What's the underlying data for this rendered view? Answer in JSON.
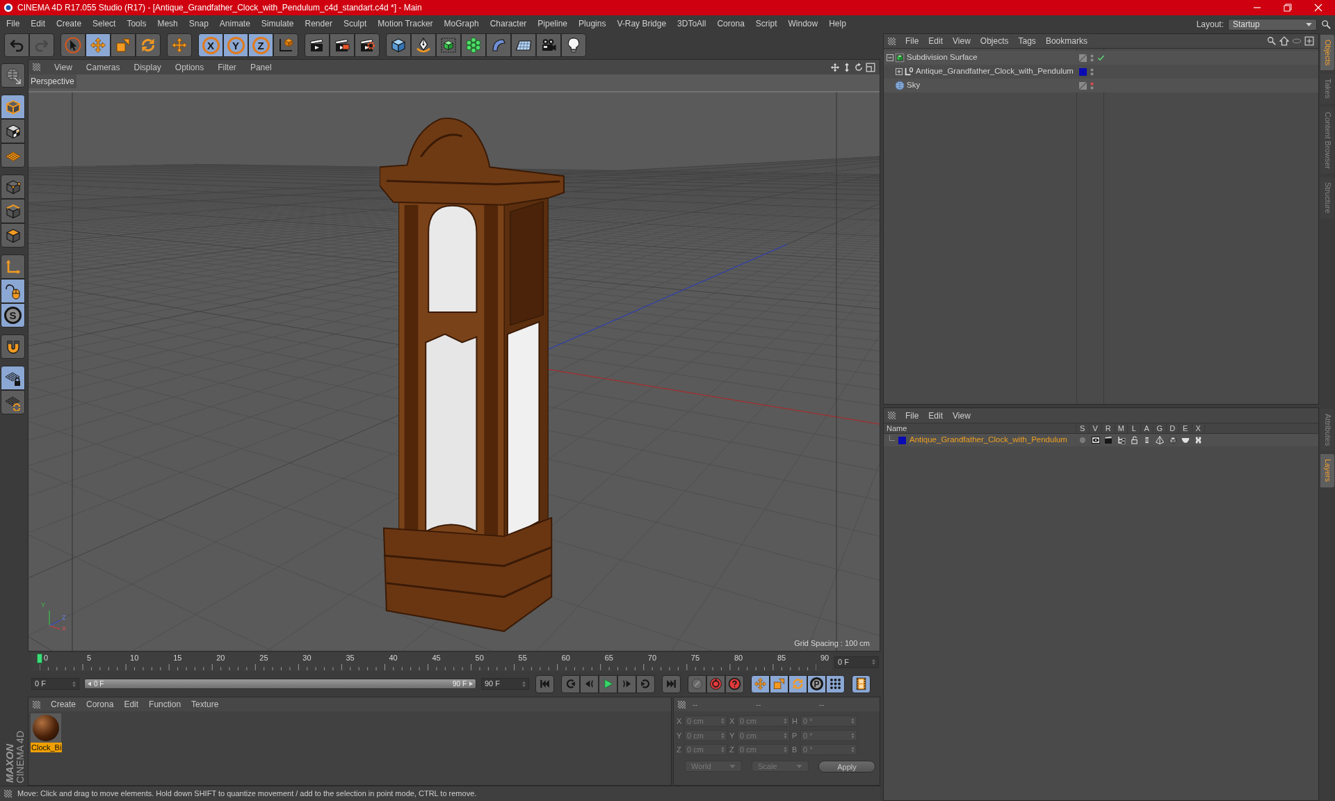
{
  "window": {
    "title": "CINEMA 4D R17.055 Studio (R17) - [Antique_Grandfather_Clock_with_Pendulum_c4d_standart.c4d *] - Main"
  },
  "menu_bar": [
    "File",
    "Edit",
    "Create",
    "Select",
    "Tools",
    "Mesh",
    "Snap",
    "Animate",
    "Simulate",
    "Render",
    "Sculpt",
    "Motion Tracker",
    "MoGraph",
    "Character",
    "Pipeline",
    "Plugins",
    "V-Ray Bridge",
    "3DToAll",
    "Corona",
    "Script",
    "Window",
    "Help"
  ],
  "layout": {
    "label": "Layout:",
    "value": "Startup"
  },
  "toolbar": [
    {
      "items": [
        {
          "kind": "undo",
          "selected": false,
          "disabled": false
        },
        {
          "kind": "redo",
          "selected": false,
          "disabled": true
        }
      ]
    },
    {
      "items": [
        {
          "kind": "select",
          "selected": false,
          "disabled": false
        },
        {
          "kind": "move",
          "selected": true,
          "disabled": false
        },
        {
          "kind": "scale",
          "selected": false,
          "disabled": false
        },
        {
          "kind": "rotate",
          "selected": false,
          "disabled": false
        }
      ]
    },
    {
      "items": [
        {
          "kind": "recent",
          "selected": false,
          "disabled": false
        }
      ]
    },
    {
      "items": [
        {
          "kind": "axis",
          "label": "X",
          "selected": true,
          "disabled": false
        },
        {
          "kind": "axis",
          "label": "Y",
          "selected": true,
          "disabled": false
        },
        {
          "kind": "axis",
          "label": "Z",
          "selected": true,
          "disabled": false
        },
        {
          "kind": "coords",
          "selected": false,
          "disabled": false
        }
      ]
    },
    {
      "items": [
        {
          "kind": "renderview",
          "selected": false,
          "disabled": false
        },
        {
          "kind": "render",
          "selected": false,
          "disabled": false
        },
        {
          "kind": "rendersettings",
          "selected": false,
          "disabled": false
        }
      ]
    },
    {
      "items": [
        {
          "kind": "cube",
          "selected": false,
          "disabled": false
        },
        {
          "kind": "pen",
          "selected": false,
          "disabled": false
        },
        {
          "kind": "subdivision",
          "selected": false,
          "disabled": false
        },
        {
          "kind": "cloner",
          "selected": false,
          "disabled": false
        },
        {
          "kind": "deformer",
          "selected": false,
          "disabled": false
        },
        {
          "kind": "floor",
          "selected": false,
          "disabled": false
        },
        {
          "kind": "camera",
          "selected": false,
          "disabled": false
        },
        {
          "kind": "light",
          "selected": false,
          "disabled": false
        }
      ]
    }
  ],
  "mode_toolbar": [
    {
      "items": [
        {
          "kind": "editable",
          "selected": false
        }
      ]
    },
    {
      "items": [
        {
          "kind": "model",
          "selected": true
        },
        {
          "kind": "texture",
          "selected": false
        },
        {
          "kind": "workplane",
          "selected": false
        }
      ]
    },
    {
      "items": [
        {
          "kind": "points",
          "selected": false
        },
        {
          "kind": "edges",
          "selected": false
        },
        {
          "kind": "polygons",
          "selected": false
        }
      ]
    },
    {
      "items": [
        {
          "kind": "axes",
          "selected": false
        },
        {
          "kind": "tweak",
          "selected": true
        },
        {
          "kind": "snap",
          "label": "S",
          "selected": true
        }
      ]
    },
    {
      "items": [
        {
          "kind": "magnet",
          "selected": false
        }
      ]
    },
    {
      "items": [
        {
          "kind": "gridlock",
          "selected": true
        },
        {
          "kind": "gridrotate",
          "selected": false
        }
      ]
    }
  ],
  "logo": {
    "brand": "MAXON",
    "product": "CINEMA 4D"
  },
  "viewport": {
    "menu": [
      "View",
      "Cameras",
      "Display",
      "Options",
      "Filter",
      "Panel"
    ],
    "camera": "Perspective",
    "grid_spacing": "Grid Spacing : 100 cm",
    "axis_labels": [
      "Y",
      "Z",
      "X"
    ]
  },
  "timeline": {
    "ticks": [
      "0",
      "5",
      "10",
      "15",
      "20",
      "25",
      "30",
      "35",
      "40",
      "45",
      "50",
      "55",
      "60",
      "65",
      "70",
      "75",
      "80",
      "85",
      "90"
    ],
    "level": 0,
    "current_frame": "0 F"
  },
  "transport": {
    "start": "0 F",
    "range": {
      "start": "0 F",
      "end": "90 F",
      "level": 1
    },
    "end": "90 F",
    "groups": [
      {
        "items": [
          {
            "kind": "first",
            "selected": false
          }
        ]
      },
      {
        "items": [
          {
            "kind": "prevkey",
            "selected": false
          },
          {
            "kind": "prevframe",
            "selected": false
          },
          {
            "kind": "play",
            "selected": false
          },
          {
            "kind": "nextframe",
            "selected": false
          },
          {
            "kind": "nextkey",
            "selected": false
          }
        ]
      },
      {
        "items": [
          {
            "kind": "last",
            "selected": false
          }
        ]
      },
      {
        "items": [
          {
            "kind": "keyoff",
            "selected": false
          },
          {
            "kind": "record",
            "selected": false
          },
          {
            "kind": "autokey",
            "selected": false
          }
        ]
      },
      {
        "items": [
          {
            "kind": "keymove",
            "selected": true
          },
          {
            "kind": "keyscale",
            "selected": true
          },
          {
            "kind": "keyrotate",
            "selected": true
          },
          {
            "kind": "keyparam",
            "label": "P",
            "selected": true
          },
          {
            "kind": "keypla",
            "selected": true
          }
        ]
      },
      {
        "items": [
          {
            "kind": "film",
            "selected": true
          }
        ]
      }
    ]
  },
  "materials": {
    "menu": [
      "Create",
      "Corona",
      "Edit",
      "Function",
      "Texture"
    ],
    "items": [
      {
        "name": "Clock_Bi",
        "selected": true
      }
    ]
  },
  "coordinates": {
    "headers": [
      "--",
      "--",
      "--"
    ],
    "rows": [
      {
        "position_axis": "X",
        "position": "0 cm",
        "size_axis": "X",
        "size": "0 cm",
        "rotation_axis": "H",
        "rotation": "0 °"
      },
      {
        "position_axis": "Y",
        "position": "0 cm",
        "size_axis": "Y",
        "size": "0 cm",
        "rotation_axis": "P",
        "rotation": "0 °"
      },
      {
        "position_axis": "Z",
        "position": "0 cm",
        "size_axis": "Z",
        "size": "0 cm",
        "rotation_axis": "B",
        "rotation": "0 °"
      }
    ],
    "mode": "World",
    "transform": "Scale",
    "apply": "Apply"
  },
  "status_bar": "Move: Click and drag to move elements. Hold down SHIFT to quantize movement / add to the selection in point mode, CTRL to remove.",
  "objects": {
    "menu": [
      "File",
      "Edit",
      "View",
      "Objects",
      "Tags",
      "Bookmarks"
    ],
    "tree": [
      {
        "name": "Subdivision Surface",
        "kind": "generator",
        "expanded": true,
        "enabled": true,
        "editor_visible": true,
        "render_visible": true,
        "children": [
          {
            "name": "Antique_Grandfather_Clock_with_Pendulum",
            "kind": "null",
            "expanded": false,
            "color": "#0a0ab4",
            "editor_visible": true,
            "render_visible": true
          }
        ]
      },
      {
        "name": "Sky",
        "kind": "sky",
        "editor_visible": false,
        "render_visible": true
      }
    ]
  },
  "layers": {
    "menu": [
      "File",
      "Edit",
      "View"
    ],
    "columns": [
      "Name",
      "S",
      "V",
      "R",
      "M",
      "L",
      "A",
      "G",
      "D",
      "E",
      "X"
    ],
    "rows": [
      {
        "name": "Antique_Grandfather_Clock_with_Pendulum",
        "color": "#0a0ab4",
        "selected": true
      }
    ]
  },
  "side_tabs_top": [
    {
      "label": "Objects",
      "selected": true
    },
    {
      "label": "Takes",
      "selected": false
    },
    {
      "label": "Content Browser",
      "selected": false
    },
    {
      "label": "Structure",
      "selected": false
    }
  ],
  "side_tabs_bottom": [
    {
      "label": "Attributes",
      "selected": false
    },
    {
      "label": "Layers",
      "selected": true
    }
  ]
}
